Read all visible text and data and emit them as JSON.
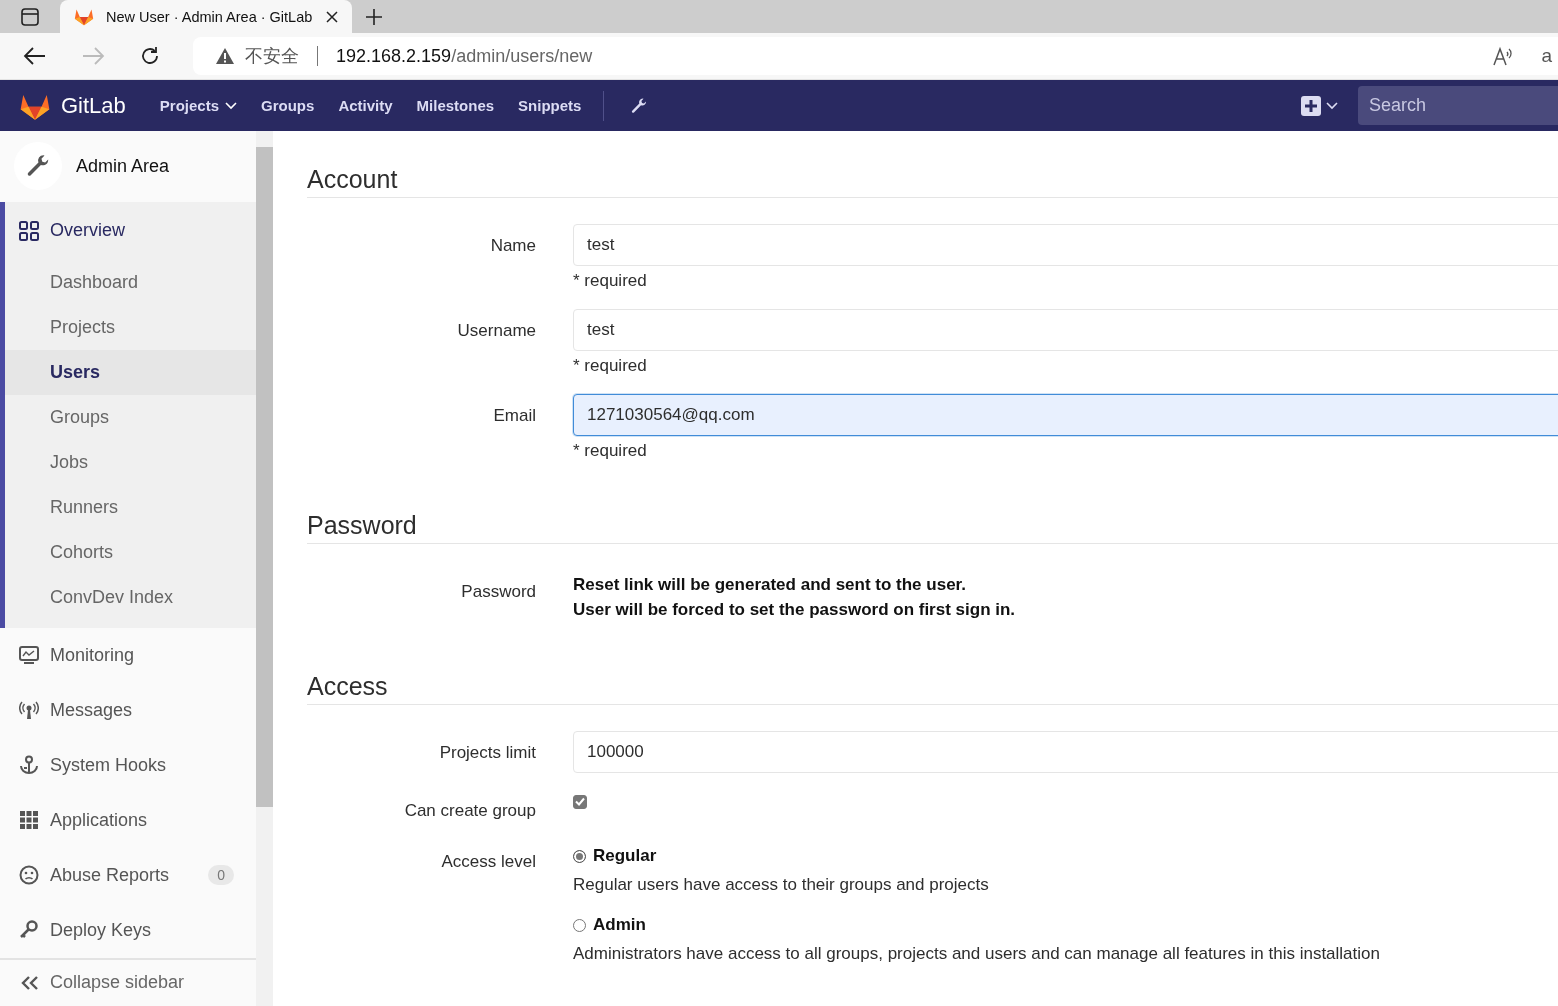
{
  "browser": {
    "tab_title": "New User · Admin Area · GitLab",
    "warning": "不安全",
    "host": "192.168.2.159",
    "path": "/admin/users/new",
    "right_text": "a"
  },
  "navbar": {
    "brand": "GitLab",
    "links": [
      {
        "label": "Projects",
        "dropdown": true
      },
      {
        "label": "Groups",
        "dropdown": false
      },
      {
        "label": "Activity",
        "dropdown": false
      },
      {
        "label": "Milestones",
        "dropdown": false
      },
      {
        "label": "Snippets",
        "dropdown": false
      }
    ],
    "search": {
      "placeholder": "Search"
    }
  },
  "sidebar": {
    "title": "Admin Area",
    "items": [
      {
        "label": "Overview",
        "expanded": true,
        "children": [
          {
            "label": "Dashboard",
            "selected": false
          },
          {
            "label": "Projects",
            "selected": false
          },
          {
            "label": "Users",
            "selected": true
          },
          {
            "label": "Groups",
            "selected": false
          },
          {
            "label": "Jobs",
            "selected": false
          },
          {
            "label": "Runners",
            "selected": false
          },
          {
            "label": "Cohorts",
            "selected": false
          },
          {
            "label": "ConvDev Index",
            "selected": false
          }
        ]
      },
      {
        "label": "Monitoring",
        "expanded": false
      },
      {
        "label": "Messages",
        "expanded": false
      },
      {
        "label": "System Hooks",
        "expanded": false
      },
      {
        "label": "Applications",
        "expanded": false
      },
      {
        "label": "Abuse Reports",
        "expanded": false,
        "badge": "0"
      },
      {
        "label": "Deploy Keys",
        "expanded": false
      }
    ],
    "collapse": "Collapse sidebar"
  },
  "sections": [
    {
      "title": "Account",
      "fields": [
        {
          "kind": "input",
          "label": "Name",
          "value": "test",
          "focused": false,
          "hint": "* required"
        },
        {
          "kind": "input",
          "label": "Username",
          "value": "test",
          "focused": false,
          "hint": "* required"
        },
        {
          "kind": "input",
          "label": "Email",
          "value": "1271030564@qq.com",
          "focused": true,
          "hint": "* required"
        }
      ]
    },
    {
      "title": "Password",
      "fields": [
        {
          "kind": "text",
          "label": "Password",
          "lines": [
            "Reset link will be generated and sent to the user.",
            "User will be forced to set the password on first sign in."
          ]
        }
      ]
    },
    {
      "title": "Access",
      "fields": [
        {
          "kind": "input",
          "label": "Projects limit",
          "value": "100000",
          "focused": false
        },
        {
          "kind": "checkbox",
          "label": "Can create group",
          "checked": true
        },
        {
          "kind": "radio",
          "label": "Access level",
          "options": [
            {
              "label": "Regular",
              "selected": true,
              "description": "Regular users have access to their groups and projects"
            },
            {
              "label": "Admin",
              "selected": false,
              "description": "Administrators have access to all groups, projects and users and can manage all features in this installation"
            }
          ]
        }
      ]
    }
  ]
}
